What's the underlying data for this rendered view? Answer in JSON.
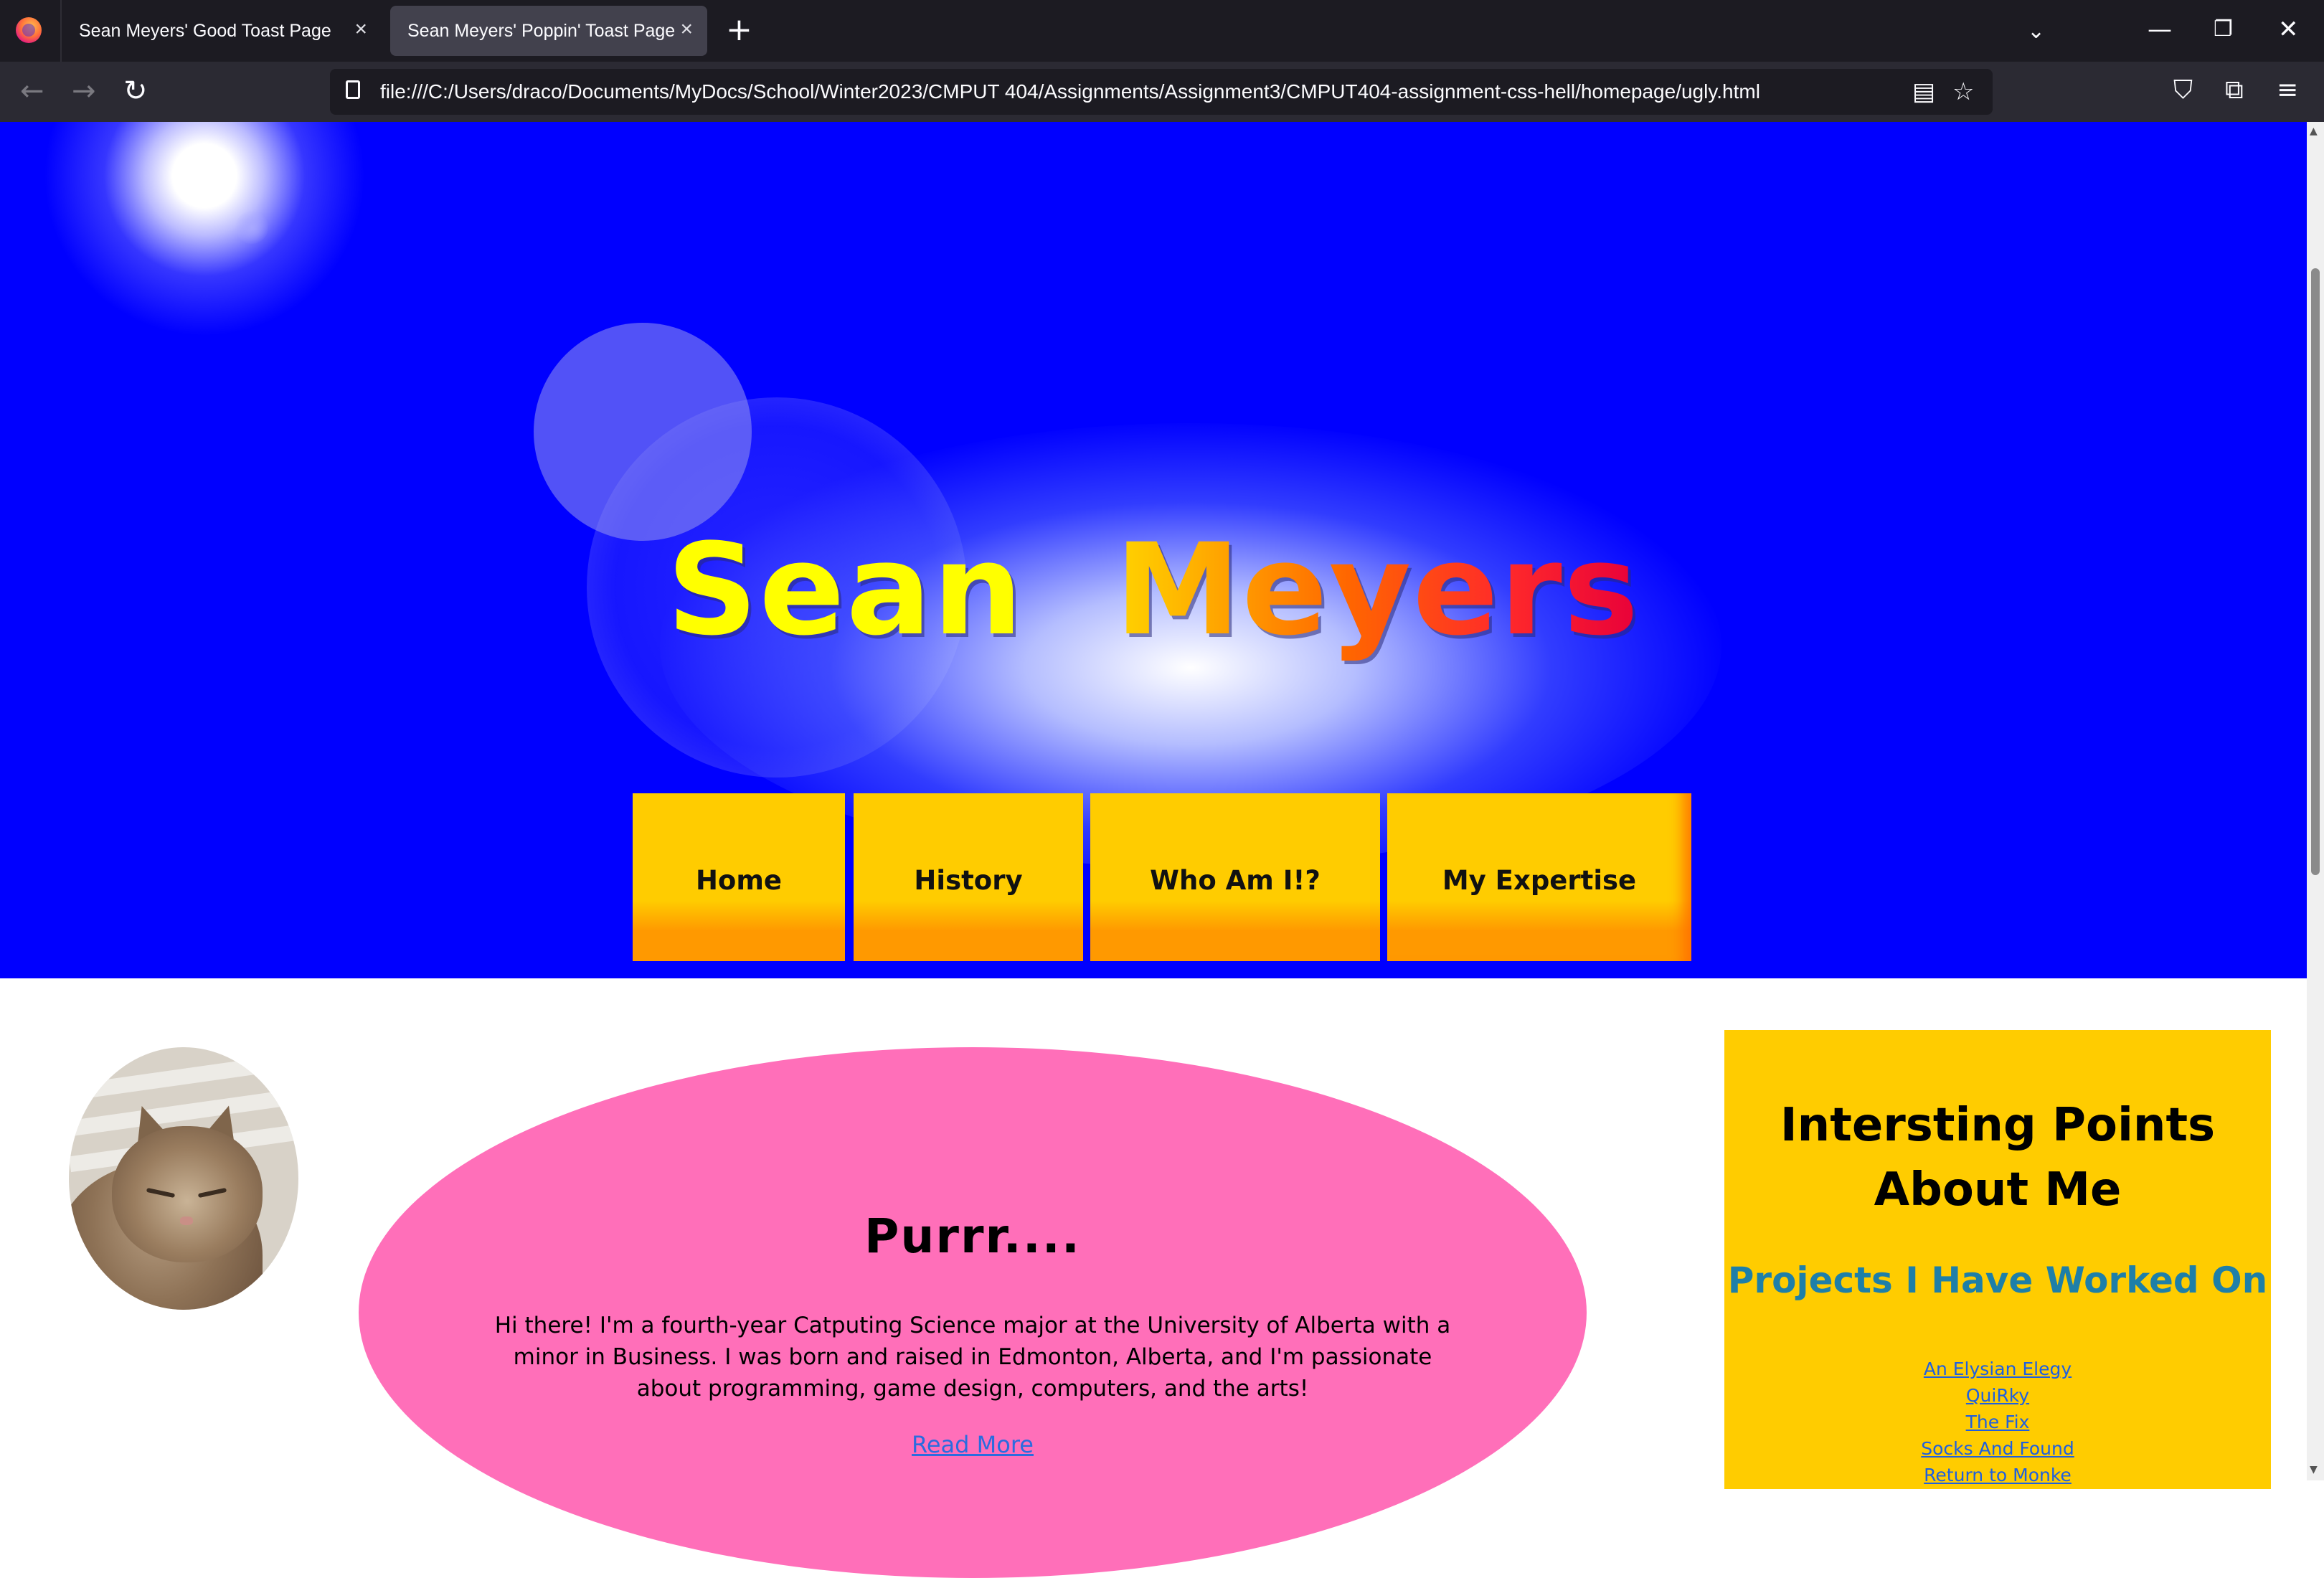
{
  "browser": {
    "tabs": [
      {
        "title": "Sean Meyers' Good Toast Page",
        "active": false
      },
      {
        "title": "Sean Meyers' Poppin' Toast Page",
        "active": true
      }
    ],
    "url": "file:///C:/Users/draco/Documents/MyDocs/School/Winter2023/CMPUT 404/Assignments/Assignment3/CMPUT404-assignment-css-hell/homepage/ugly.html",
    "icons": {
      "logo": "firefox-logo-icon",
      "close": "×",
      "new_tab": "+",
      "tab_list": "⌄",
      "minimize": "—",
      "restore": "❐",
      "window_close": "✕",
      "back": "←",
      "forward": "→",
      "reload": "↻",
      "reader": "▤",
      "bookmark": "☆",
      "pocket": "⛉",
      "extensions": "⧉",
      "menu": "≡"
    }
  },
  "header": {
    "title_first": "Sean",
    "title_last": "Meyers",
    "background_color": "#0000ff",
    "nav": [
      "Home",
      "History",
      "Who Am I!?",
      "My Expertise"
    ],
    "nav_colors": {
      "top": "#ffcc00",
      "bottom": "#ff9900"
    }
  },
  "bio": {
    "heading": "Purrr....",
    "text": "Hi there! I'm a fourth-year Catputing Science major at the University of Alberta with a minor in Business. I was born and raised in Edmonton, Alberta, and I'm passionate about programming, game design, computers, and the arts!",
    "read_more": "Read More",
    "oval_color": "#ff6fb9"
  },
  "sidebar": {
    "title": "Intersting Points About Me",
    "subtitle": "Projects I Have Worked On",
    "links": [
      "An Elysian Elegy",
      "QuiRky",
      "The Fix",
      "Socks And Found",
      "Return to Monke"
    ],
    "background_color": "#ffcc00"
  }
}
